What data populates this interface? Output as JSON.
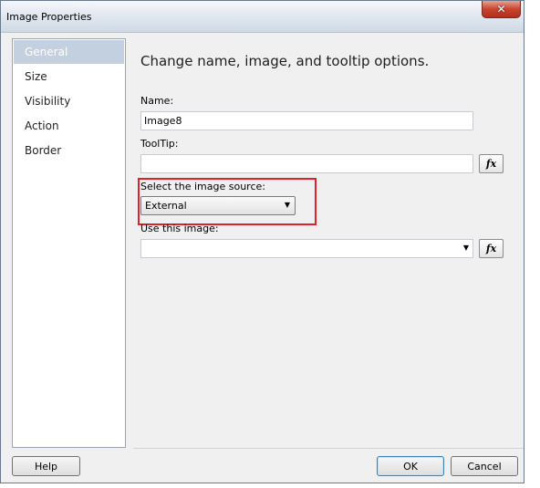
{
  "window": {
    "title": "Image Properties",
    "close_glyph": "✕"
  },
  "nav": {
    "items": [
      {
        "label": "General",
        "selected": true
      },
      {
        "label": "Size",
        "selected": false
      },
      {
        "label": "Visibility",
        "selected": false
      },
      {
        "label": "Action",
        "selected": false
      },
      {
        "label": "Border",
        "selected": false
      }
    ]
  },
  "general": {
    "heading": "Change name, image, and tooltip options.",
    "name_label": "Name:",
    "name_value": "Image8",
    "tooltip_label": "ToolTip:",
    "tooltip_value": "",
    "source_label": "Select the image source:",
    "source_value": "External",
    "use_image_label": "Use this image:",
    "use_image_value": "",
    "fx_label": "fx"
  },
  "buttons": {
    "help": "Help",
    "ok": "OK",
    "cancel": "Cancel"
  },
  "colors": {
    "highlight": "#e0202a",
    "nav_selected": "#c3d0df",
    "close_button": "#c7442f"
  },
  "icons": {
    "close": "close-icon",
    "dropdown": "chevron-down-icon",
    "expression": "fx-icon"
  }
}
